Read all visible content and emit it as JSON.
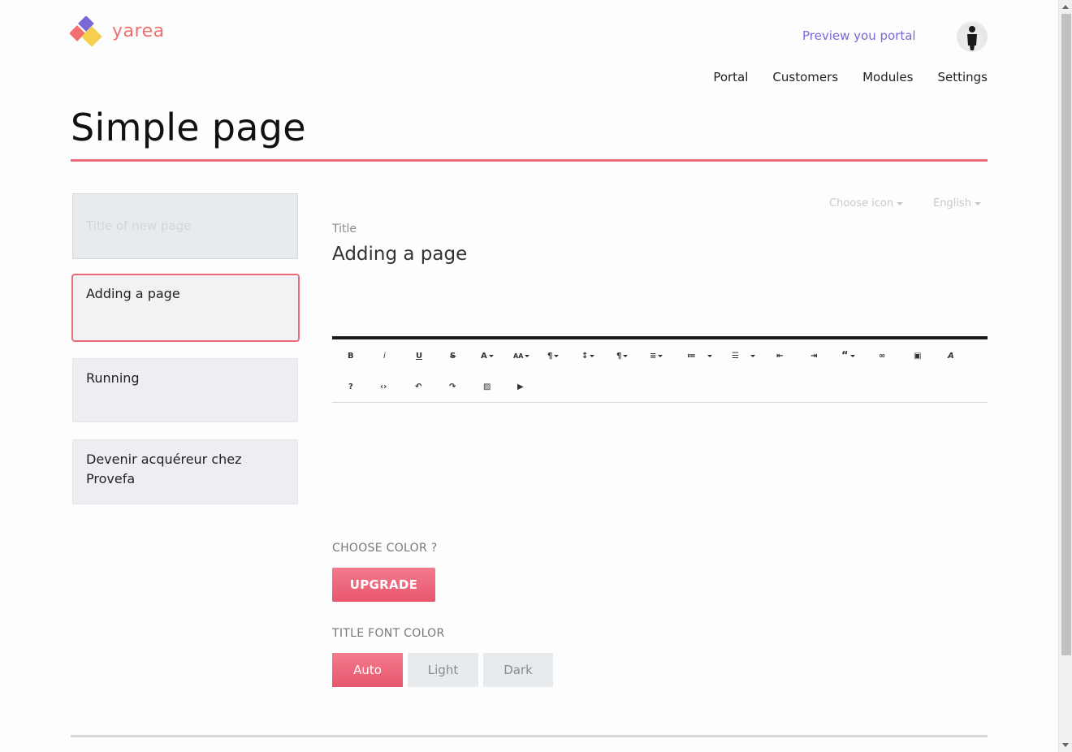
{
  "brand": {
    "name": "yarea",
    "color": "#f07070"
  },
  "header": {
    "preview_link": "Preview you portal"
  },
  "nav": [
    {
      "label": "Portal"
    },
    {
      "label": "Customers"
    },
    {
      "label": "Modules"
    },
    {
      "label": "Settings"
    }
  ],
  "page": {
    "title": "Simple page"
  },
  "pages_list": {
    "new_placeholder": "Title of new page",
    "items": [
      {
        "label": "Adding a page",
        "active": true
      },
      {
        "label": "Running"
      },
      {
        "label": "Devenir acquéreur chez Provefa"
      }
    ]
  },
  "editor": {
    "choose_icon": "Choose icon",
    "language": "English",
    "title_label": "Title",
    "title_value": "Adding a page",
    "toolbar_row1": [
      {
        "name": "bold",
        "glyph": "B"
      },
      {
        "name": "italic",
        "glyph": "i"
      },
      {
        "name": "underline",
        "glyph": "U"
      },
      {
        "name": "strikethrough",
        "glyph": "S"
      },
      {
        "name": "font-color",
        "glyph": "A"
      },
      {
        "name": "font-size",
        "glyph": "AA"
      },
      {
        "name": "paragraph-style",
        "glyph": "¶"
      },
      {
        "name": "line-height",
        "glyph": "↕"
      },
      {
        "name": "paragraph-format",
        "glyph": "¶"
      },
      {
        "name": "align",
        "glyph": "≡"
      },
      {
        "name": "ordered-list",
        "glyph": "≔"
      },
      {
        "name": "unordered-list",
        "glyph": "☰"
      },
      {
        "name": "outdent",
        "glyph": "⇤"
      },
      {
        "name": "indent",
        "glyph": "⇥"
      },
      {
        "name": "quote",
        "glyph": "“"
      },
      {
        "name": "link",
        "glyph": "∞"
      },
      {
        "name": "select-all",
        "glyph": "▣"
      },
      {
        "name": "clear-formatting",
        "glyph": "A"
      }
    ],
    "toolbar_row2": [
      {
        "name": "help",
        "glyph": "?"
      },
      {
        "name": "code-view",
        "glyph": "‹›"
      },
      {
        "name": "undo",
        "glyph": "↶"
      },
      {
        "name": "redo",
        "glyph": "↷"
      },
      {
        "name": "insert-image",
        "glyph": "▨"
      },
      {
        "name": "insert-video",
        "glyph": "▶"
      }
    ]
  },
  "color_section": {
    "label": "CHOOSE COLOR ?",
    "button": "UPGRADE"
  },
  "font_color_section": {
    "label": "TITLE FONT COLOR",
    "options": [
      "Auto",
      "Light",
      "Dark"
    ],
    "selected": "Auto"
  },
  "colors": {
    "accent": "#ec6b7b",
    "link": "#7b67d6"
  }
}
